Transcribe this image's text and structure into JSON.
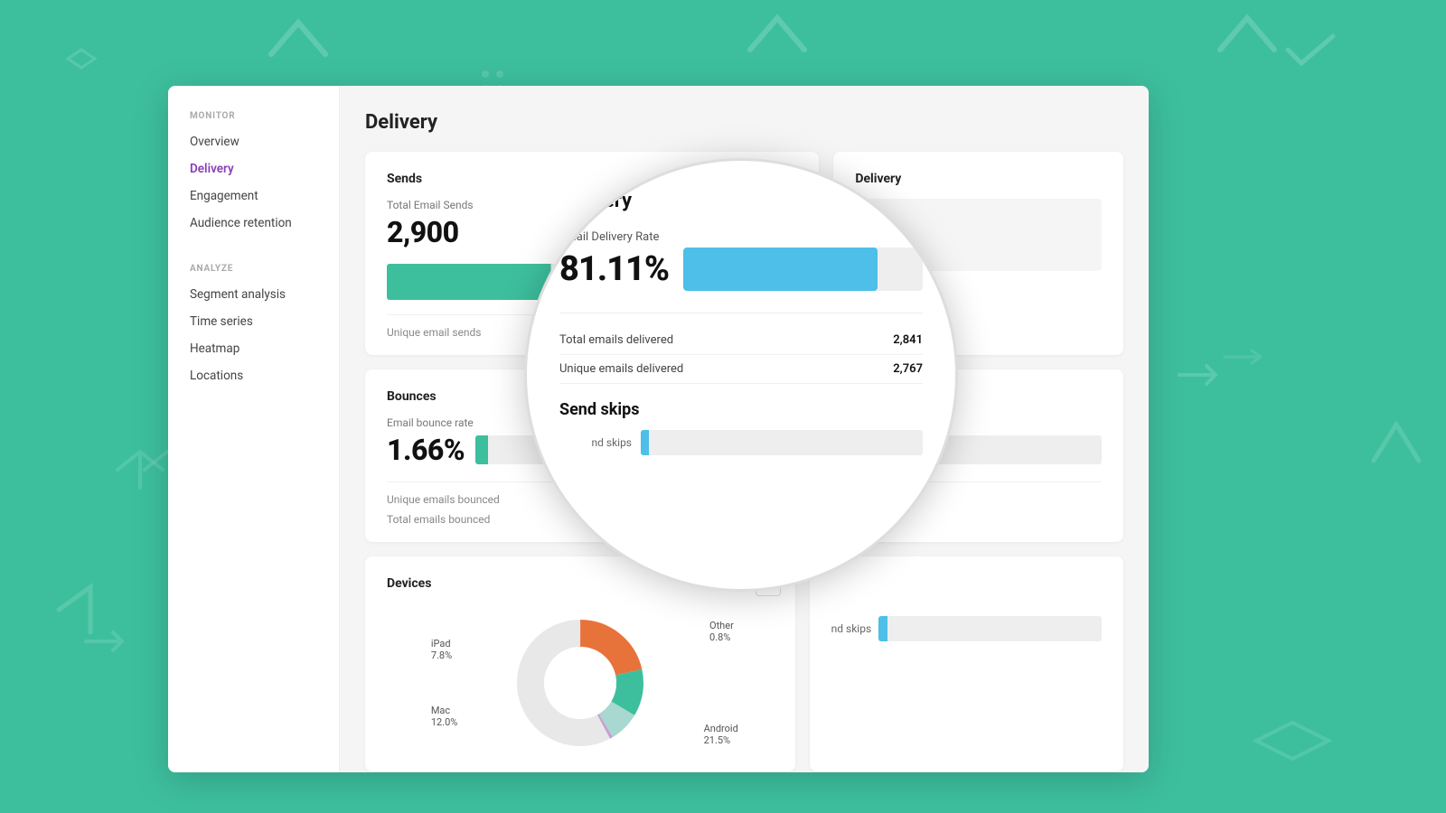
{
  "background": {
    "color": "#3dbf9e"
  },
  "sidebar": {
    "monitor_label": "MONITOR",
    "analyze_label": "ANALYZE",
    "items_monitor": [
      {
        "id": "overview",
        "label": "Overview",
        "active": false
      },
      {
        "id": "delivery",
        "label": "Delivery",
        "active": true
      },
      {
        "id": "engagement",
        "label": "Engagement",
        "active": false
      },
      {
        "id": "audience-retention",
        "label": "Audience retention",
        "active": false
      }
    ],
    "items_analyze": [
      {
        "id": "segment-analysis",
        "label": "Segment analysis",
        "active": false
      },
      {
        "id": "time-series",
        "label": "Time series",
        "active": false
      },
      {
        "id": "heatmap",
        "label": "Heatmap",
        "active": false
      },
      {
        "id": "locations",
        "label": "Locations",
        "active": false
      }
    ]
  },
  "page": {
    "title": "Delivery"
  },
  "sends_card": {
    "title": "Sends",
    "metric_label": "Total Email Sends",
    "metric_value": "2,900",
    "sub_label": "Unique email sends"
  },
  "delivery_card": {
    "title": "Delivery",
    "visible": true
  },
  "bounces_card": {
    "title": "Bounces",
    "metric_label": "Email bounce rate",
    "metric_value": "1.66%",
    "sub_label_1": "Unique emails bounced",
    "sub_label_2": "Total emails bounced",
    "bar_fill_pct": 2
  },
  "devices_card": {
    "title": "Devices",
    "menu_icon": "⋮",
    "donut_segments": [
      {
        "label": "Android",
        "pct": "21.5%",
        "color": "#e8733a"
      },
      {
        "label": "Mac",
        "pct": "12.0%",
        "color": "#3dbf9e"
      },
      {
        "label": "iPad",
        "pct": "7.8%",
        "color": "#a8d8d0"
      },
      {
        "label": "Other",
        "pct": "0.8%",
        "color": "#c8a0d0"
      }
    ]
  },
  "zoom_overlay": {
    "title": "Delivery",
    "rate_label": "Email Delivery Rate",
    "rate_value": "81.11%",
    "bar_fill_pct": 81.11,
    "stats": [
      {
        "label": "Total emails delivered",
        "value": "2,841"
      },
      {
        "label": "Unique emails delivered",
        "value": "2,767"
      }
    ],
    "send_skips_title": "Send skips",
    "skip_label": "nd skips",
    "skip_bar_pct": 3
  }
}
